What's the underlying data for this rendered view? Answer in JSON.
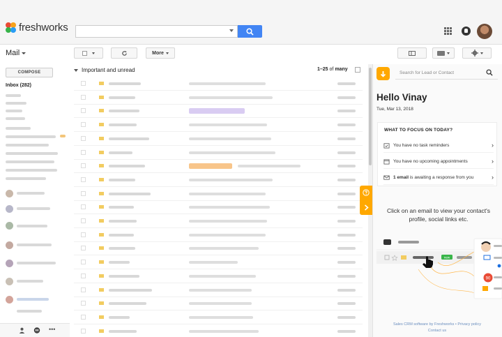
{
  "header": {
    "logo_text": "freshworks",
    "brand_colors": [
      "#e94b35",
      "#f7a21b",
      "#2a9df4",
      "#37b34a"
    ],
    "search_button_color": "#4285f4"
  },
  "toolbar": {
    "mail_label": "Mail",
    "more_label": "More"
  },
  "sidebar": {
    "compose_label": "COMPOSE",
    "inbox_label": "Inbox (282)"
  },
  "list": {
    "section_title": "Important and unread",
    "pager_range": "1–25",
    "pager_of": "of",
    "pager_total": "many"
  },
  "panel": {
    "accent": "#ffa800",
    "search_placeholder": "Search for Lead or Contact",
    "greeting": "Hello Vinay",
    "date": "Tue, Mar 13, 2018",
    "focus_title": "WHAT TO FOCUS ON TODAY?",
    "focus_items": [
      {
        "text": "You have no task reminders",
        "icon": "calendar-check-icon"
      },
      {
        "text": "You have no upcoming appointments",
        "icon": "calendar-icon"
      },
      {
        "bold": "1 email",
        "text": " is awaiting a response from you",
        "icon": "envelope-icon"
      }
    ],
    "hint": "Click on an email to view your contact's profile, social links etc.",
    "illustration": {
      "badge_new": "new",
      "badge_number": "90"
    },
    "footer_line1": "Sales CRM software by Freshworks",
    "footer_separator": "•",
    "footer_privacy": "Privacy policy",
    "footer_contact": "Contact us"
  }
}
